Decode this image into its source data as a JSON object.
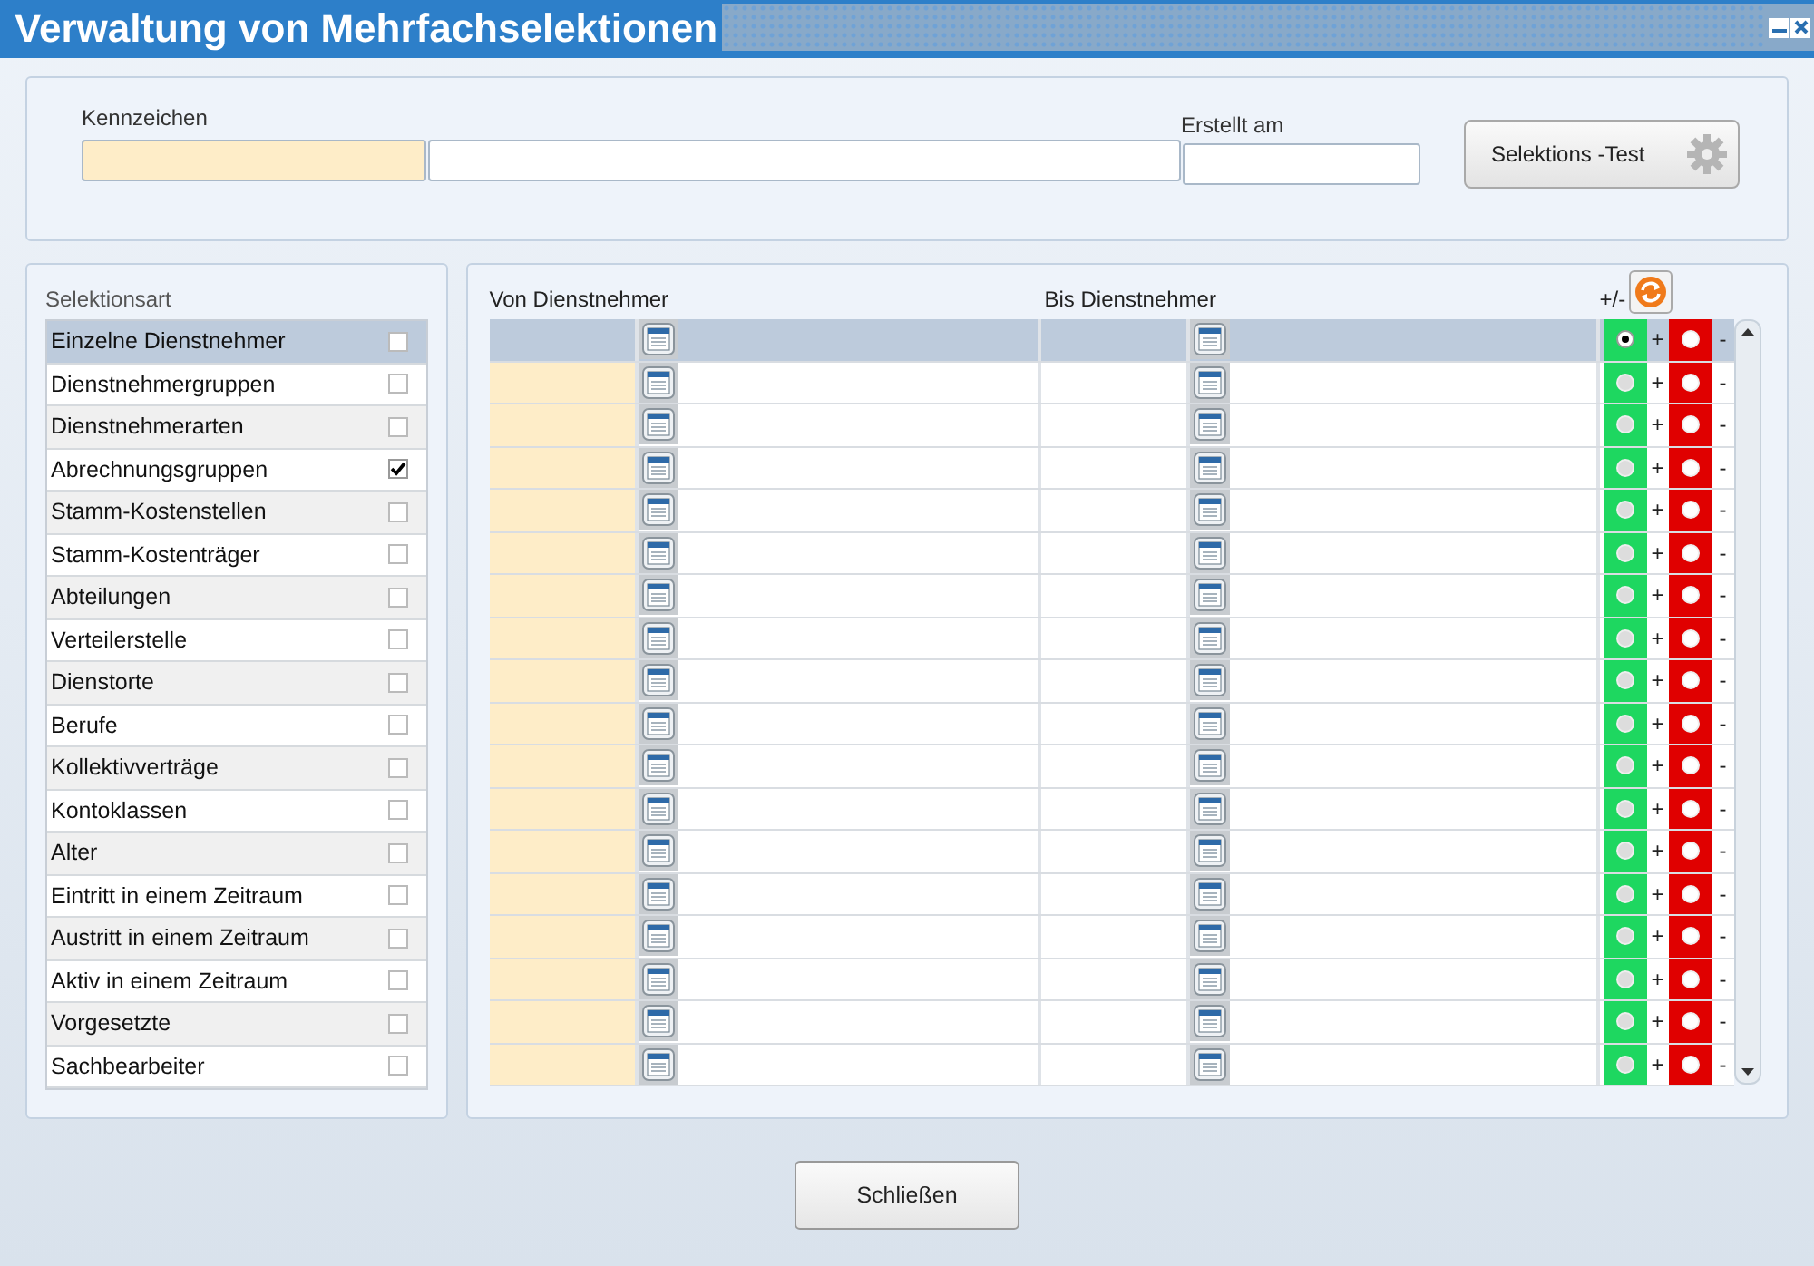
{
  "window": {
    "title": "Verwaltung von Mehrfachselektionen"
  },
  "header": {
    "kennzeichen_label": "Kennzeichen",
    "erstellt_label": "Erstellt am",
    "test_button": "Selektions -Test"
  },
  "selection_types": {
    "title": "Selektionsart",
    "items": [
      {
        "label": "Einzelne Dienstnehmer",
        "selected": true,
        "checked": false
      },
      {
        "label": "Dienstnehmergruppen",
        "selected": false,
        "checked": false
      },
      {
        "label": "Dienstnehmerarten",
        "selected": false,
        "checked": false
      },
      {
        "label": "Abrechnungsgruppen",
        "selected": false,
        "checked": true
      },
      {
        "label": "Stamm-Kostenstellen",
        "selected": false,
        "checked": false
      },
      {
        "label": "Stamm-Kostenträger",
        "selected": false,
        "checked": false
      },
      {
        "label": "Abteilungen",
        "selected": false,
        "checked": false
      },
      {
        "label": "Verteilerstelle",
        "selected": false,
        "checked": false
      },
      {
        "label": "Dienstorte",
        "selected": false,
        "checked": false
      },
      {
        "label": "Berufe",
        "selected": false,
        "checked": false
      },
      {
        "label": "Kollektivverträge",
        "selected": false,
        "checked": false
      },
      {
        "label": "Kontoklassen",
        "selected": false,
        "checked": false
      },
      {
        "label": "Alter",
        "selected": false,
        "checked": false
      },
      {
        "label": "Eintritt in einem Zeitraum",
        "selected": false,
        "checked": false
      },
      {
        "label": "Austritt in einem Zeitraum",
        "selected": false,
        "checked": false
      },
      {
        "label": "Aktiv in einem Zeitraum",
        "selected": false,
        "checked": false
      },
      {
        "label": "Vorgesetzte",
        "selected": false,
        "checked": false
      },
      {
        "label": "Sachbearbeiter",
        "selected": false,
        "checked": false
      }
    ]
  },
  "grid": {
    "columns": [
      "Von Dienstnehmer",
      "Bis Dienstnehmer",
      "+/-"
    ],
    "rows": [
      {
        "selected": true,
        "plus": {
          "label": "+",
          "selected": true
        },
        "minus": {
          "label": "-",
          "selected": false
        }
      },
      {
        "selected": false,
        "plus": {
          "label": "+",
          "selected": false
        },
        "minus": {
          "label": "-",
          "selected": false
        }
      },
      {
        "selected": false,
        "plus": {
          "label": "+",
          "selected": false
        },
        "minus": {
          "label": "-",
          "selected": false
        }
      },
      {
        "selected": false,
        "plus": {
          "label": "+",
          "selected": false
        },
        "minus": {
          "label": "-",
          "selected": false
        }
      },
      {
        "selected": false,
        "plus": {
          "label": "+",
          "selected": false
        },
        "minus": {
          "label": "-",
          "selected": false
        }
      },
      {
        "selected": false,
        "plus": {
          "label": "+",
          "selected": false
        },
        "minus": {
          "label": "-",
          "selected": false
        }
      },
      {
        "selected": false,
        "plus": {
          "label": "+",
          "selected": false
        },
        "minus": {
          "label": "-",
          "selected": false
        }
      },
      {
        "selected": false,
        "plus": {
          "label": "+",
          "selected": false
        },
        "minus": {
          "label": "-",
          "selected": false
        }
      },
      {
        "selected": false,
        "plus": {
          "label": "+",
          "selected": false
        },
        "minus": {
          "label": "-",
          "selected": false
        }
      },
      {
        "selected": false,
        "plus": {
          "label": "+",
          "selected": false
        },
        "minus": {
          "label": "-",
          "selected": false
        }
      },
      {
        "selected": false,
        "plus": {
          "label": "+",
          "selected": false
        },
        "minus": {
          "label": "-",
          "selected": false
        }
      },
      {
        "selected": false,
        "plus": {
          "label": "+",
          "selected": false
        },
        "minus": {
          "label": "-",
          "selected": false
        }
      },
      {
        "selected": false,
        "plus": {
          "label": "+",
          "selected": false
        },
        "minus": {
          "label": "-",
          "selected": false
        }
      },
      {
        "selected": false,
        "plus": {
          "label": "+",
          "selected": false
        },
        "minus": {
          "label": "-",
          "selected": false
        }
      },
      {
        "selected": false,
        "plus": {
          "label": "+",
          "selected": false
        },
        "minus": {
          "label": "-",
          "selected": false
        }
      },
      {
        "selected": false,
        "plus": {
          "label": "+",
          "selected": false
        },
        "minus": {
          "label": "-",
          "selected": false
        }
      },
      {
        "selected": false,
        "plus": {
          "label": "+",
          "selected": false
        },
        "minus": {
          "label": "-",
          "selected": false
        }
      },
      {
        "selected": false,
        "plus": {
          "label": "+",
          "selected": false
        },
        "minus": {
          "label": "-",
          "selected": false
        }
      }
    ]
  },
  "footer": {
    "close_button": "Schließen"
  }
}
